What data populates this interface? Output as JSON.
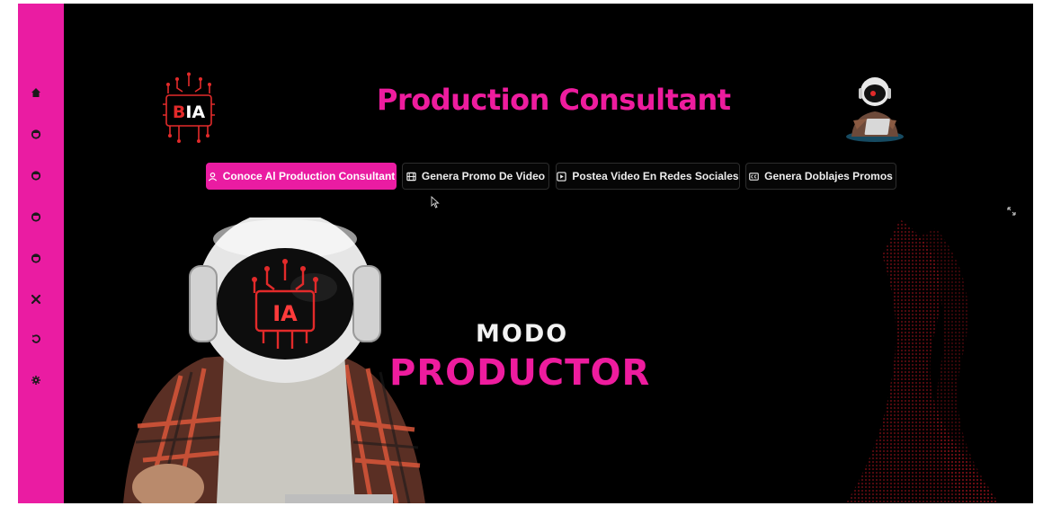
{
  "app": {
    "title": "Production Consultant",
    "logo_text": "BIA",
    "accent_color": "#ea1ca2"
  },
  "sidebar": {
    "items": [
      {
        "icon": "home-icon"
      },
      {
        "icon": "circle-icon"
      },
      {
        "icon": "circle-icon"
      },
      {
        "icon": "circle-icon"
      },
      {
        "icon": "circle-icon"
      },
      {
        "icon": "x-icon"
      },
      {
        "icon": "refresh-icon"
      },
      {
        "icon": "gear-icon"
      }
    ]
  },
  "tabs": [
    {
      "label": "Conoce Al Production Consultant",
      "icon": "user-icon",
      "active": true
    },
    {
      "label": "Genera Promo De Video",
      "icon": "film-icon",
      "active": false
    },
    {
      "label": "Postea Video En Redes Sociales",
      "icon": "play-square-icon",
      "active": false
    },
    {
      "label": "Genera Doblajes Promos",
      "icon": "cc-icon",
      "active": false
    }
  ],
  "hero": {
    "mode_label": "MODO",
    "mode_value": "PRODUCTOR",
    "helmet_text": "IA"
  }
}
